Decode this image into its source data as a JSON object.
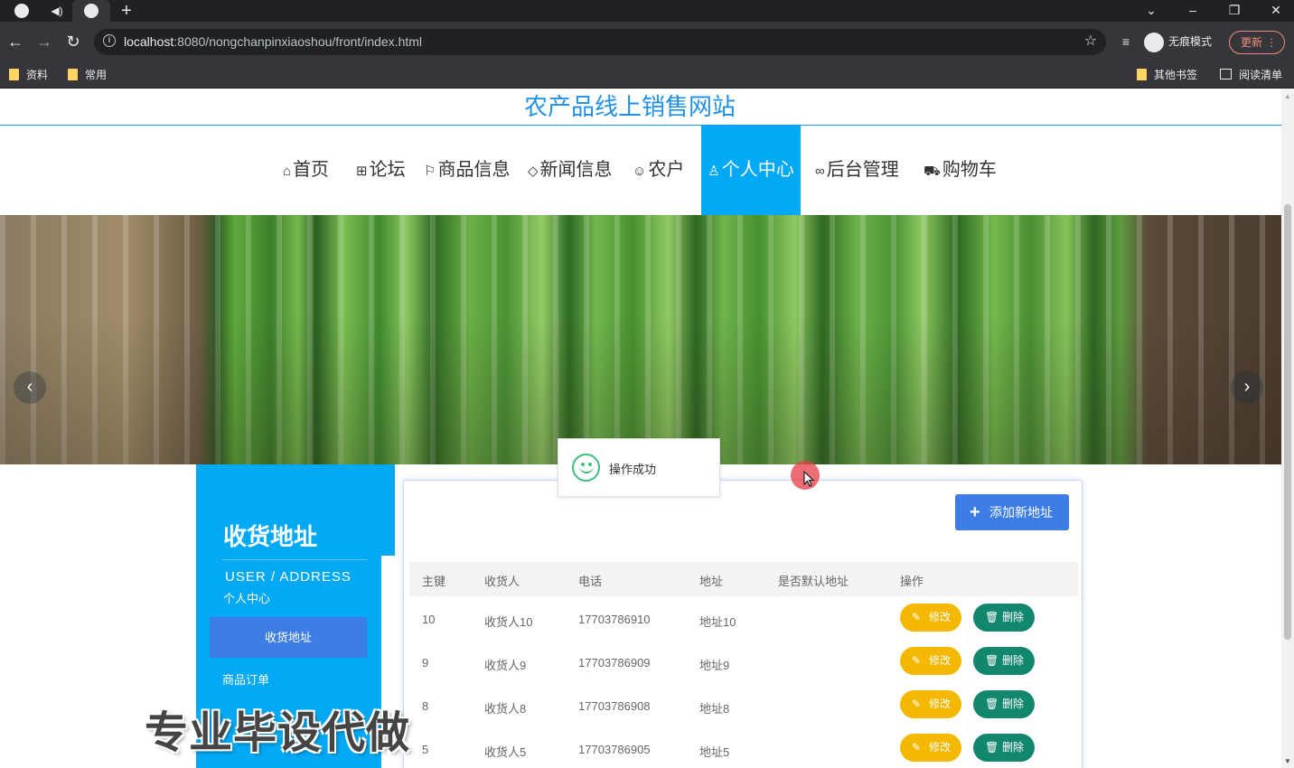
{
  "browser": {
    "url_host": "localhost",
    "url_rest": ":8080/nongchanpinxiaoshou/front/index.html",
    "incognito_label": "无痕模式",
    "update_label": "更新",
    "bookmarks": [
      "资料",
      "常用"
    ],
    "other_bookmarks": "其他书签",
    "reading_list": "阅读清单"
  },
  "site": {
    "title": "农产品线上销售网站"
  },
  "nav": {
    "items": [
      {
        "icon": "home-icon",
        "label": "首页"
      },
      {
        "icon": "forum-icon",
        "label": "论坛"
      },
      {
        "icon": "flag-icon",
        "label": "商品信息"
      },
      {
        "icon": "tag-icon",
        "label": "新闻信息"
      },
      {
        "icon": "face-icon",
        "label": "农户"
      },
      {
        "icon": "user-icon",
        "label": "个人中心"
      },
      {
        "icon": "link-icon",
        "label": "后台管理"
      },
      {
        "icon": "cart-icon",
        "label": "购物车"
      }
    ],
    "active_index": 5
  },
  "sidebar": {
    "title": "收货地址",
    "subtitle_en": "USER / ADDRESS",
    "subtitle_cn": "个人中心",
    "menu": [
      {
        "label": "收货地址",
        "active": true
      },
      {
        "label": "商品订单",
        "active": false
      }
    ]
  },
  "toast": {
    "message": "操作成功"
  },
  "address_table": {
    "add_button": "添加新地址",
    "columns": [
      "主键",
      "收货人",
      "电话",
      "地址",
      "是否默认地址",
      "操作"
    ],
    "edit_label": "修改",
    "delete_label": "删除",
    "rows": [
      {
        "id": "10",
        "receiver": "收货人10",
        "phone": "17703786910",
        "address": "地址10",
        "is_default": ""
      },
      {
        "id": "9",
        "receiver": "收货人9",
        "phone": "17703786909",
        "address": "地址9",
        "is_default": ""
      },
      {
        "id": "8",
        "receiver": "收货人8",
        "phone": "17703786908",
        "address": "地址8",
        "is_default": ""
      },
      {
        "id": "5",
        "receiver": "收货人5",
        "phone": "17703786905",
        "address": "地址5",
        "is_default": ""
      }
    ]
  },
  "watermark": "专业毕设代做",
  "colors": {
    "accent": "#03a9f4",
    "primary_button": "#3d7de6",
    "edit_button": "#f5b800",
    "delete_button": "#13866e",
    "title": "#1e90e6"
  }
}
